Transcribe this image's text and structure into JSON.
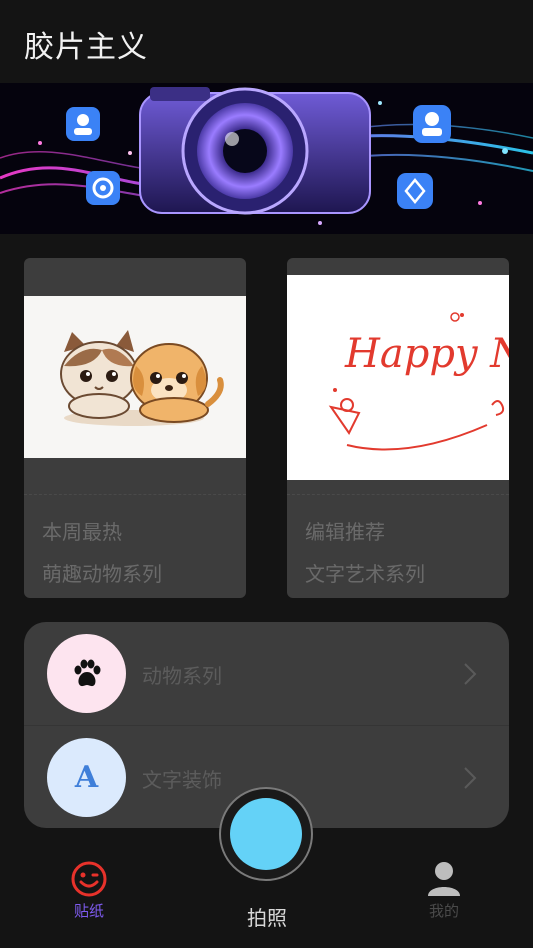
{
  "header": {
    "title": "胶片主义"
  },
  "cards": [
    {
      "tag": "本周最热",
      "subtitle": "萌趣动物系列",
      "image": "puppy-kitten-illustration"
    },
    {
      "tag": "编辑推荐",
      "subtitle": "文字艺术系列",
      "image": "happy-new-year-lettering",
      "image_text": "Happy New Year"
    }
  ],
  "categories": [
    {
      "label": "动物系列",
      "icon": "paw-icon",
      "icon_bg": "#fde4ef"
    },
    {
      "label": "文字装饰",
      "icon": "letter-a-icon",
      "icon_glyph": "A",
      "icon_bg": "#dbeafd"
    }
  ],
  "tabbar": {
    "stickers_label": "贴纸",
    "shoot_label": "拍照",
    "mine_label": "我的",
    "active_color": "#7e5bef",
    "shutter_color": "#64d2f7"
  }
}
